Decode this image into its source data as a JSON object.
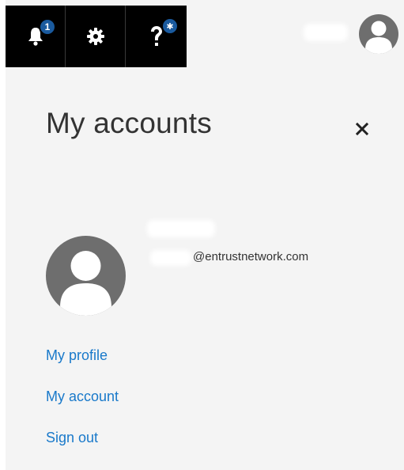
{
  "header": {
    "notifications": {
      "icon": "bell-icon",
      "badge_count": "1"
    },
    "settings": {
      "icon": "gear-icon"
    },
    "help": {
      "icon": "question-icon",
      "badge_symbol": "✱"
    },
    "user_avatar_icon": "user-avatar-icon"
  },
  "panel": {
    "title": "My accounts",
    "close_icon": "close-icon",
    "account": {
      "email_suffix": "@entrustnetwork.com"
    },
    "links": {
      "profile": "My profile",
      "account": "My account",
      "sign_out": "Sign out"
    }
  },
  "colors": {
    "link": "#1979ca",
    "badge": "#1a5a9e",
    "header_bg": "#000000",
    "panel_bg": "#f4f4f4",
    "avatar_bg": "#6e6e6e"
  }
}
